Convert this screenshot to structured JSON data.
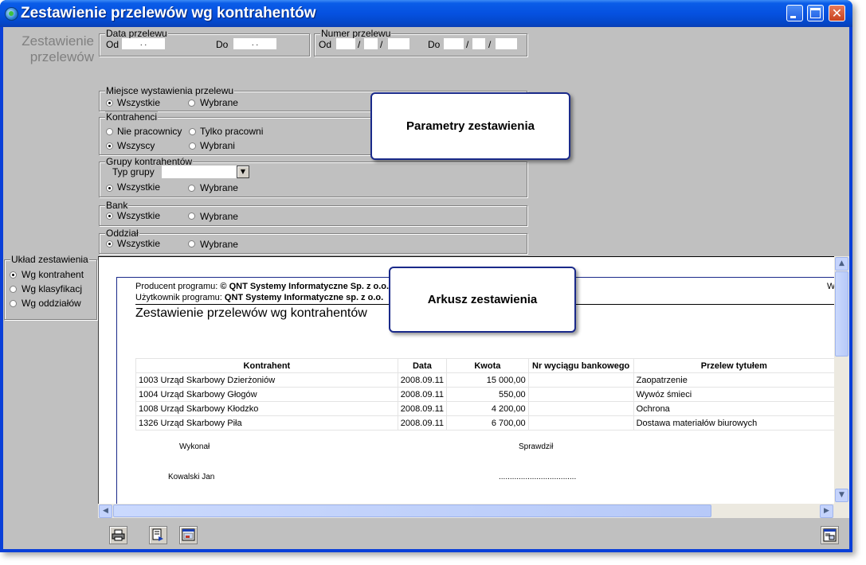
{
  "window": {
    "title": "Zestawienie przelewów wg kontrahentów"
  },
  "left_panel": {
    "label_line1": "Zestawienie",
    "label_line2": "przelewów",
    "layout_group": {
      "title": "Układ zestawienia",
      "options": [
        "Wg kontrahent",
        "Wg klasyfikacj",
        "Wg oddziałów"
      ],
      "selected": 0
    }
  },
  "filters": {
    "date_group": {
      "title": "Data przelewu",
      "from_label": "Od",
      "to_label": "Do",
      "from_value": ". .",
      "to_value": ". ."
    },
    "number_group": {
      "title": "Numer przelewu",
      "from_label": "Od",
      "to_label": "Do",
      "sep": "/"
    },
    "place_group": {
      "title": "Miejsce wystawienia przelewu",
      "opt_all": "Wszystkie",
      "opt_selected": "Wybrane"
    },
    "contractors_group": {
      "title": "Kontrahenci",
      "opt_non_employees": "Nie pracownicy",
      "opt_only_employees": "Tylko pracowni",
      "opt_all": "Wszyscy",
      "opt_selected": "Wybrani"
    },
    "contractor_groups": {
      "title": "Grupy kontrahentów",
      "type_label": "Typ grupy",
      "type_value": "",
      "opt_all": "Wszystkie",
      "opt_selected": "Wybrane"
    },
    "bank_group": {
      "title": "Bank",
      "opt_all": "Wszystkie",
      "opt_selected": "Wybrane"
    },
    "branch_group": {
      "title": "Oddział",
      "opt_all": "Wszystkie",
      "opt_selected": "Wybrane"
    }
  },
  "callouts": {
    "params": "Parametry zestawienia",
    "sheet": "Arkusz zestawienia"
  },
  "report": {
    "producer_label": "Producent programu:",
    "producer_value": "© QNT Systemy Informatyczne Sp. z o.o.",
    "user_label": "Użytkownik programu:",
    "user_value": "QNT Systemy Informatyczne sp. z o.o.",
    "right_edge": "W",
    "title": "Zestawienie przelewów wg kontrahentów",
    "columns": [
      "Kontrahent",
      "Data",
      "Kwota",
      "Nr wyciągu bankowego",
      "Przelew tytułem"
    ],
    "rows": [
      [
        "1003 Urząd Skarbowy Dzierżoniów",
        "2008.09.11",
        "15 000,00",
        "",
        "Zaopatrzenie"
      ],
      [
        "1004 Urząd Skarbowy Głogów",
        "2008.09.11",
        "550,00",
        "",
        "Wywóz śmieci"
      ],
      [
        "1008 Urząd Skarbowy Kłodzko",
        "2008.09.11",
        "4 200,00",
        "",
        "Ochrona"
      ],
      [
        "1326 Urząd Skarbowy Piła",
        "2008.09.11",
        "6 700,00",
        "",
        "Dostawa materiałów biurowych"
      ]
    ],
    "made_by_label": "Wykonał",
    "checked_by_label": "Sprawdził",
    "made_by_name": "Kowalski Jan",
    "checked_by_line": "..................................."
  },
  "icons": {
    "print": "printer-icon",
    "export": "export-icon",
    "preview": "preview-icon",
    "settings": "settings-icon"
  }
}
